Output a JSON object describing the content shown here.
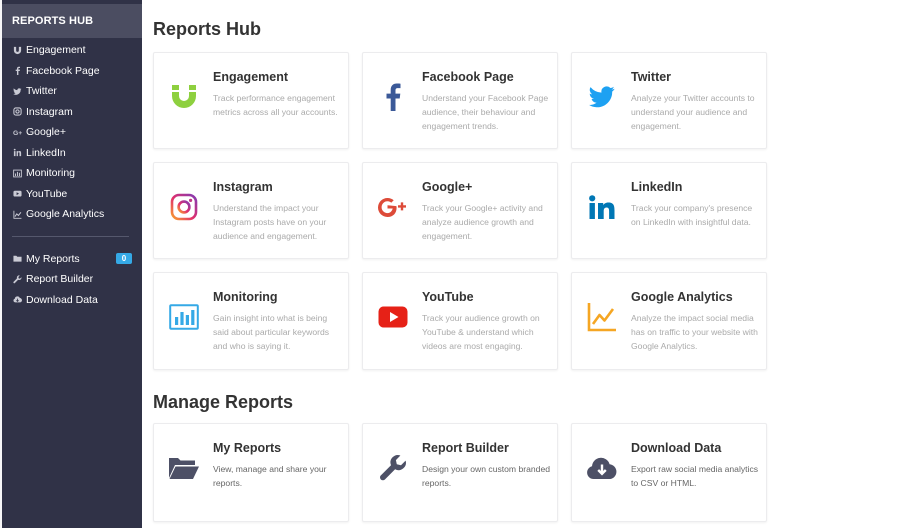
{
  "sidebar": {
    "header": "REPORTS HUB",
    "items": [
      {
        "label": "Engagement"
      },
      {
        "label": "Facebook Page"
      },
      {
        "label": "Twitter"
      },
      {
        "label": "Instagram"
      },
      {
        "label": "Google+"
      },
      {
        "label": "LinkedIn"
      },
      {
        "label": "Monitoring"
      },
      {
        "label": "YouTube"
      },
      {
        "label": "Google Analytics"
      }
    ],
    "manage_items": [
      {
        "label": "My Reports",
        "badge": "0"
      },
      {
        "label": "Report Builder"
      },
      {
        "label": "Download Data"
      }
    ]
  },
  "main": {
    "title": "Reports Hub",
    "cards": [
      {
        "title": "Engagement",
        "desc": "Track performance engagement metrics across all your accounts.",
        "icon": "magnet-icon",
        "color": "#8ed03f"
      },
      {
        "title": "Facebook Page",
        "desc": "Understand your Facebook Page audience, their behaviour and engagement trends.",
        "icon": "facebook-icon",
        "color": "#3b5998"
      },
      {
        "title": "Twitter",
        "desc": "Analyze your Twitter accounts to understand your audience and engagement.",
        "icon": "twitter-icon",
        "color": "#1da1f2"
      },
      {
        "title": "Instagram",
        "desc": "Understand the impact your Instagram posts have on your audience and engagement.",
        "icon": "instagram-icon",
        "color": "#c13584"
      },
      {
        "title": "Google+",
        "desc": "Track your Google+ activity and analyze audience growth and engagement.",
        "icon": "google-plus-icon",
        "color": "#dd4b39"
      },
      {
        "title": "LinkedIn",
        "desc": "Track your company's presence on LinkedIn with insightful data.",
        "icon": "linkedin-icon",
        "color": "#0077b5"
      },
      {
        "title": "Monitoring",
        "desc": "Gain insight into what is being said about particular keywords and who is saying it.",
        "icon": "bar-chart-icon",
        "color": "#35a9e6"
      },
      {
        "title": "YouTube",
        "desc": "Track your audience growth on YouTube & understand which videos are most engaging.",
        "icon": "youtube-icon",
        "color": "#e62117"
      },
      {
        "title": "Google Analytics",
        "desc": "Analyze the impact social media has on traffic to your website with Google Analytics.",
        "icon": "analytics-icon",
        "color": "#f5a623"
      }
    ],
    "manage_title": "Manage Reports",
    "manage_cards": [
      {
        "title": "My Reports",
        "desc": "View, manage and share your reports.",
        "icon": "folder-icon",
        "color": "#4d5066"
      },
      {
        "title": "Report Builder",
        "desc": "Design your own custom branded reports.",
        "icon": "wrench-icon",
        "color": "#4d5066"
      },
      {
        "title": "Download Data",
        "desc": "Export raw social media analytics to CSV or HTML.",
        "icon": "cloud-download-icon",
        "color": "#4d5066"
      }
    ]
  }
}
